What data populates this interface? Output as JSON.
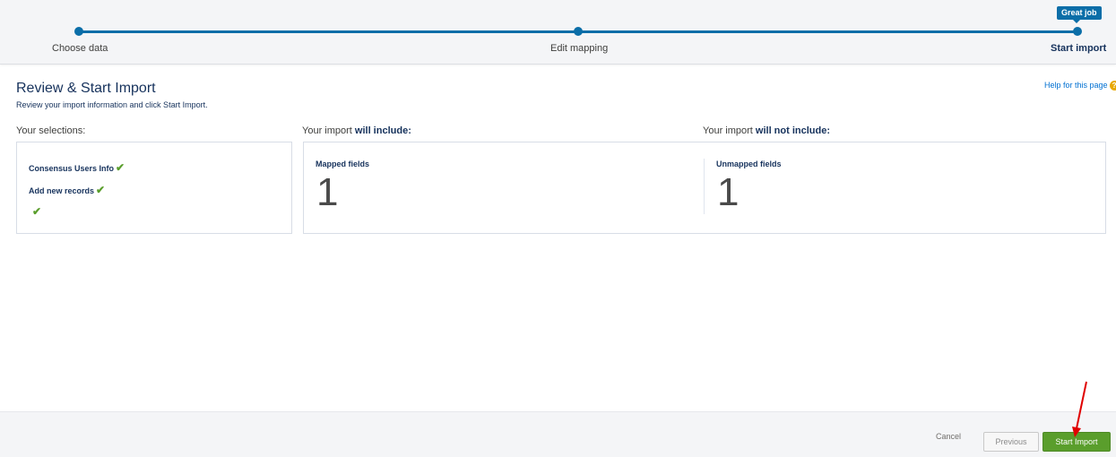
{
  "progress": {
    "steps": [
      {
        "label": "Choose data"
      },
      {
        "label": "Edit mapping"
      },
      {
        "label": "Start import"
      }
    ],
    "badge": "Great job",
    "accent_color": "#0b6ea8"
  },
  "header": {
    "title": "Review & Start Import",
    "subtitle": "Review your import information and click Start Import.",
    "help_link": "Help for this page",
    "help_icon": "question-icon"
  },
  "selections": {
    "heading": "Your selections:",
    "items": [
      {
        "label": "Consensus Users Info",
        "icon": "checkmark-icon"
      },
      {
        "label": "Add new records",
        "icon": "checkmark-icon"
      },
      {
        "label": "",
        "icon": "checkmark-icon"
      }
    ]
  },
  "include": {
    "heading_prefix": "Your import ",
    "heading_bold": "will include:",
    "label": "Mapped fields",
    "count": "1"
  },
  "exclude": {
    "heading_prefix": "Your import ",
    "heading_bold": "will not include:",
    "label": "Unmapped fields",
    "count": "1"
  },
  "footer": {
    "cancel": "Cancel",
    "previous": "Previous",
    "start": "Start Import",
    "start_color": "#5a9e2c"
  }
}
